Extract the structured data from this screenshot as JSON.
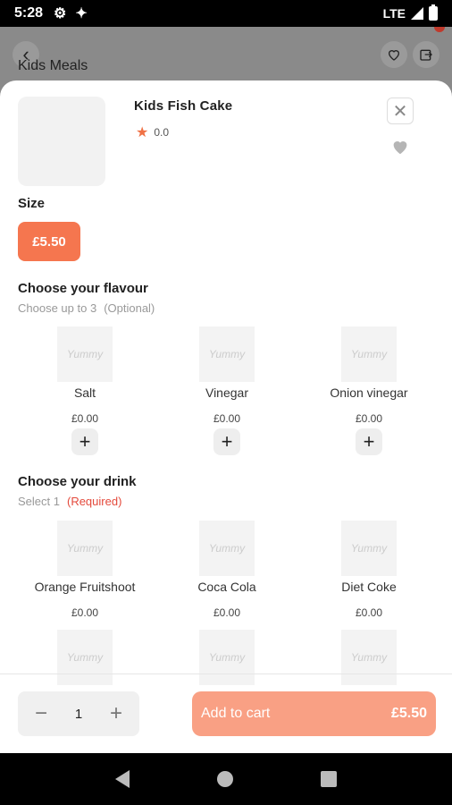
{
  "status_bar": {
    "time": "5:28",
    "network": "LTE"
  },
  "background": {
    "title": "Kids Meals"
  },
  "product": {
    "name": "Kids Fish Cake",
    "rating": "0.0"
  },
  "size": {
    "label": "Size",
    "option": "£5.50"
  },
  "flavour": {
    "title": "Choose your flavour",
    "subtitle": "Choose up to 3",
    "note": "(Optional)",
    "items": [
      {
        "name": "Salt",
        "price": "£0.00"
      },
      {
        "name": "Vinegar",
        "price": "£0.00"
      },
      {
        "name": "Onion vinegar",
        "price": "£0.00"
      }
    ]
  },
  "drink": {
    "title": "Choose your drink",
    "subtitle": "Select 1",
    "note": "(Required)",
    "items": [
      {
        "name": "Orange Fruitshoot",
        "price": "£0.00"
      },
      {
        "name": "Coca Cola",
        "price": "£0.00"
      },
      {
        "name": "Diet Coke",
        "price": "£0.00"
      }
    ]
  },
  "footer": {
    "quantity": "1",
    "cart_label": "Add to cart",
    "cart_price": "£5.50"
  },
  "colors": {
    "accent": "#f5764f",
    "cart_button": "#f9a084",
    "required": "#e44a3c"
  }
}
